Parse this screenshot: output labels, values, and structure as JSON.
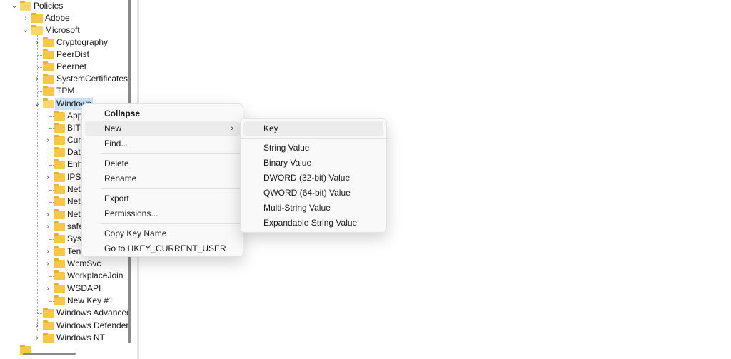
{
  "tree": {
    "nodes": [
      {
        "label": "Policies",
        "expander": "down"
      },
      {
        "label": "Adobe",
        "expander": "right"
      },
      {
        "label": "Microsoft",
        "expander": "down"
      },
      {
        "label": "Cryptography",
        "expander": "right"
      },
      {
        "label": "PeerDist",
        "expander": ""
      },
      {
        "label": "Peernet",
        "expander": ""
      },
      {
        "label": "SystemCertificates",
        "expander": "right"
      },
      {
        "label": "TPM",
        "expander": ""
      },
      {
        "label": "Windows",
        "expander": "down"
      },
      {
        "label": "App",
        "expander": ""
      },
      {
        "label": "BITS",
        "expander": ""
      },
      {
        "label": "Cur",
        "expander": "right"
      },
      {
        "label": "Dat",
        "expander": ""
      },
      {
        "label": "Enh",
        "expander": ""
      },
      {
        "label": "IPSe",
        "expander": "right"
      },
      {
        "label": "Net",
        "expander": ""
      },
      {
        "label": "Net",
        "expander": ""
      },
      {
        "label": "Net",
        "expander": "right"
      },
      {
        "label": "safe",
        "expander": "right"
      },
      {
        "label": "Syst",
        "expander": ""
      },
      {
        "label": "Tena",
        "expander": "right"
      },
      {
        "label": "WcmSvc",
        "expander": "right"
      },
      {
        "label": "WorkplaceJoin",
        "expander": ""
      },
      {
        "label": "WSDAPI",
        "expander": "right"
      },
      {
        "label": "New Key #1",
        "expander": ""
      },
      {
        "label": "Windows Advanced",
        "expander": ""
      },
      {
        "label": "Windows Defender",
        "expander": "right"
      },
      {
        "label": "Windows NT",
        "expander": "right"
      }
    ]
  },
  "context_menu": {
    "items": [
      {
        "label": "Collapse",
        "bold": true
      },
      {
        "label": "New",
        "submenu": true
      },
      {
        "label": "Find..."
      },
      {
        "label": "Delete"
      },
      {
        "label": "Rename"
      },
      {
        "label": "Export"
      },
      {
        "label": "Permissions..."
      },
      {
        "label": "Copy Key Name"
      },
      {
        "label": "Go to HKEY_CURRENT_USER"
      }
    ],
    "submenu_arrow": "›"
  },
  "new_submenu": {
    "items": [
      {
        "label": "Key"
      },
      {
        "label": "String Value"
      },
      {
        "label": "Binary Value"
      },
      {
        "label": "DWORD (32-bit) Value"
      },
      {
        "label": "QWORD (64-bit) Value"
      },
      {
        "label": "Multi-String Value"
      },
      {
        "label": "Expandable String Value"
      }
    ]
  },
  "icons": {
    "expanded": "chevron-down-icon",
    "collapsed": "chevron-right-icon",
    "folder": "folder-icon"
  }
}
